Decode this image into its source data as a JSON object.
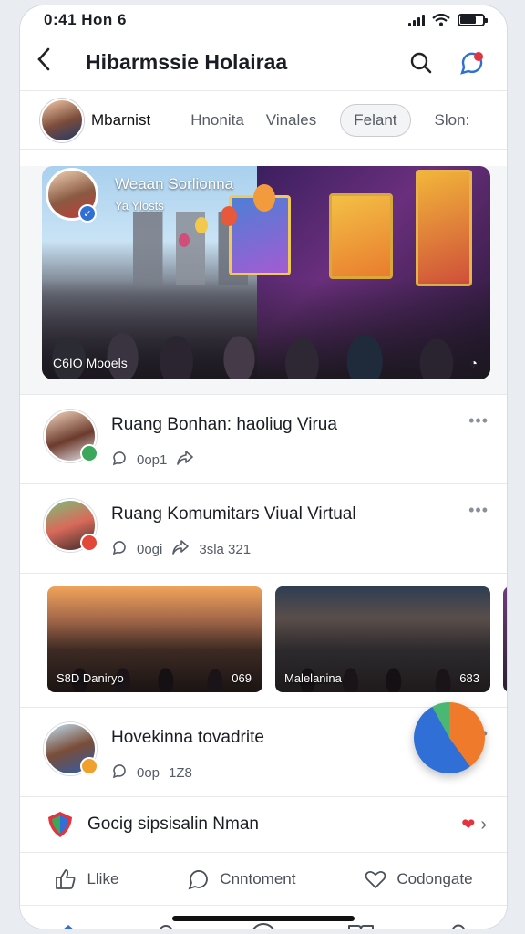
{
  "status_bar": {
    "time": "0:41  Hon 6"
  },
  "header": {
    "title": "Hibarmssie Holairaa"
  },
  "tabs": [
    {
      "label": "Mbarnist"
    },
    {
      "label": "Hnonita"
    },
    {
      "label": "Vinales"
    },
    {
      "label": "Felant",
      "selected": true
    },
    {
      "label": "Slon:"
    }
  ],
  "hero": {
    "title": "Weaan Sorlionna",
    "subtitle": "Ya Ylosts",
    "caption": "C6IO Mooels"
  },
  "posts": [
    {
      "title": "Ruang Bonhan: haoliug Virua",
      "count": "0op1",
      "extra": "",
      "badge_color": "#3aa75a"
    },
    {
      "title": "Ruang Komumitars Viual Virtual",
      "count": "0ogi",
      "extra": "3sla 321",
      "badge_color": "#e1483a"
    }
  ],
  "thumbnails": [
    {
      "label": "S8D Daniryo",
      "count": "069"
    },
    {
      "label": "Malelanina",
      "count": "683"
    }
  ],
  "post3": {
    "title": "Hovekinna tovadrite",
    "count": "0op",
    "extra": "1Z8"
  },
  "group_row": {
    "title": "Gocig sipsisalin Nman"
  },
  "actions": {
    "like": "Llike",
    "comment": "Cnntoment",
    "share": "Codongate"
  },
  "colors": {
    "accent": "#2f6fd6",
    "heart": "#e2333f"
  }
}
